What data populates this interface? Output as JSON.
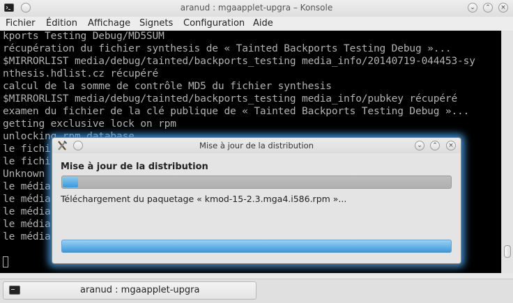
{
  "konsole": {
    "title": "aranud : mgaapplet-upgra – Konsole",
    "menu": [
      "Fichier",
      "Édition",
      "Affichage",
      "Signets",
      "Configuration",
      "Aide"
    ],
    "lines": [
      "kports Testing Debug/MD5SUM",
      "récupération du fichier synthesis de « Tainted Backports Testing Debug »...",
      "$MIRRORLIST media/debug/tainted/backports_testing media_info/20140719-044453-sy",
      "nthesis.hdlist.cz récupéré",
      "calcul de la somme de contrôle MD5 du fichier synthesis",
      "$MIRRORLIST media/debug/tainted/backports_testing media_info/pubkey récupéré",
      "examen du fichier de la clé publique de « Tainted Backports Testing Debug »...",
      "getting exclusive lock on rpm",
      "unlocking rpm database",
      "le fichi",
      "le fichi",
      "Unknown",
      "le média",
      "le média",
      "le média",
      "le média",
      "le média"
    ]
  },
  "dialog": {
    "title": "Mise à jour de la distribution",
    "heading": "Mise à jour de la distribution",
    "progress_fraction": 0.04,
    "status": "Téléchargement du paquetage « kmod-15-2.3.mga4.i586.rpm »...",
    "progress2_fraction": 1.0
  },
  "taskbar": {
    "task_label": "aranud : mgaapplet-upgra"
  }
}
